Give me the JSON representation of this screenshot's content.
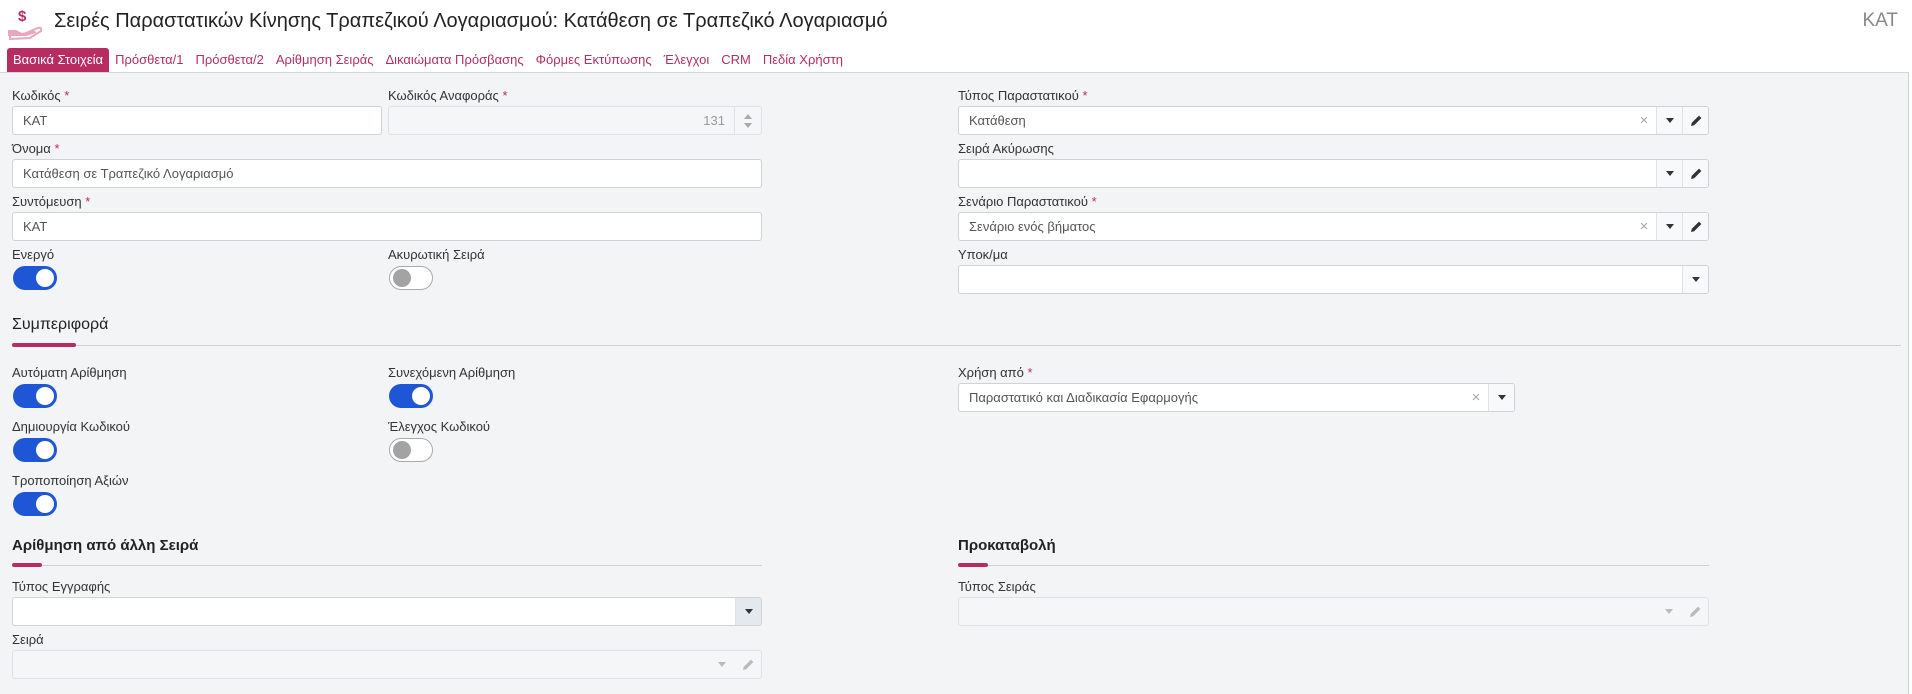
{
  "header": {
    "title": "Σειρές Παραστατικών Κίνησης Τραπεζικού Λογαριασμού: Κατάθεση σε Τραπεζικό Λογαριασμό",
    "code": "ΚΑΤ",
    "icon": "money-hand-icon",
    "accent_color": "#b72d62"
  },
  "tabs": [
    {
      "label": "Βασικά Στοιχεία",
      "active": true
    },
    {
      "label": "Πρόσθετα/1"
    },
    {
      "label": "Πρόσθετα/2"
    },
    {
      "label": "Αρίθμηση Σειράς"
    },
    {
      "label": "Δικαιώματα Πρόσβασης"
    },
    {
      "label": "Φόρμες Εκτύπωσης"
    },
    {
      "label": "Έλεγχοι"
    },
    {
      "label": "CRM"
    },
    {
      "label": "Πεδία Χρήστη"
    }
  ],
  "required_mark": "*",
  "form": {
    "code": {
      "label": "Κωδικός",
      "value": "ΚΑΤ"
    },
    "ref_code": {
      "label": "Κωδικός Αναφοράς",
      "value": "131"
    },
    "doc_type": {
      "label": "Τύπος Παραστατικού",
      "value": "Κατάθεση"
    },
    "name": {
      "label": "Όνομα",
      "value": "Κατάθεση σε Τραπεζικό Λογαριασμό"
    },
    "cancel_series": {
      "label": "Σειρά Ακύρωσης",
      "value": ""
    },
    "abbreviation": {
      "label": "Συντόμευση",
      "value": "ΚΑΤ"
    },
    "doc_scenario": {
      "label": "Σενάριο Παραστατικού",
      "value": "Σενάριο ενός βήματος"
    },
    "active": {
      "label": "Ενεργό",
      "on": true
    },
    "cancelling_series": {
      "label": "Ακυρωτική Σειρά",
      "on": false
    },
    "branch": {
      "label": "Υποκ/μα",
      "value": ""
    }
  },
  "behavior": {
    "title": "Συμπεριφορά",
    "auto_numbering": {
      "label": "Αυτόματη Αρίθμηση",
      "on": true
    },
    "continuous_numbering": {
      "label": "Συνεχόμενη Αρίθμηση",
      "on": true
    },
    "used_by": {
      "label": "Χρήση από",
      "value": "Παραστατικό και Διαδικασία Εφαρμογής"
    },
    "code_creation": {
      "label": "Δημιουργία Κωδικού",
      "on": true
    },
    "code_check": {
      "label": "Έλεγχος Κωδικού",
      "on": false
    },
    "value_modification": {
      "label": "Τροποποίηση Αξιών",
      "on": true
    }
  },
  "numbering_other": {
    "title": "Αρίθμηση από άλλη Σειρά",
    "record_type": {
      "label": "Τύπος Εγγραφής",
      "value": ""
    },
    "series": {
      "label": "Σειρά",
      "value": ""
    }
  },
  "advance": {
    "title": "Προκαταβολή",
    "series_type": {
      "label": "Τύπος Σειράς",
      "value": ""
    }
  }
}
